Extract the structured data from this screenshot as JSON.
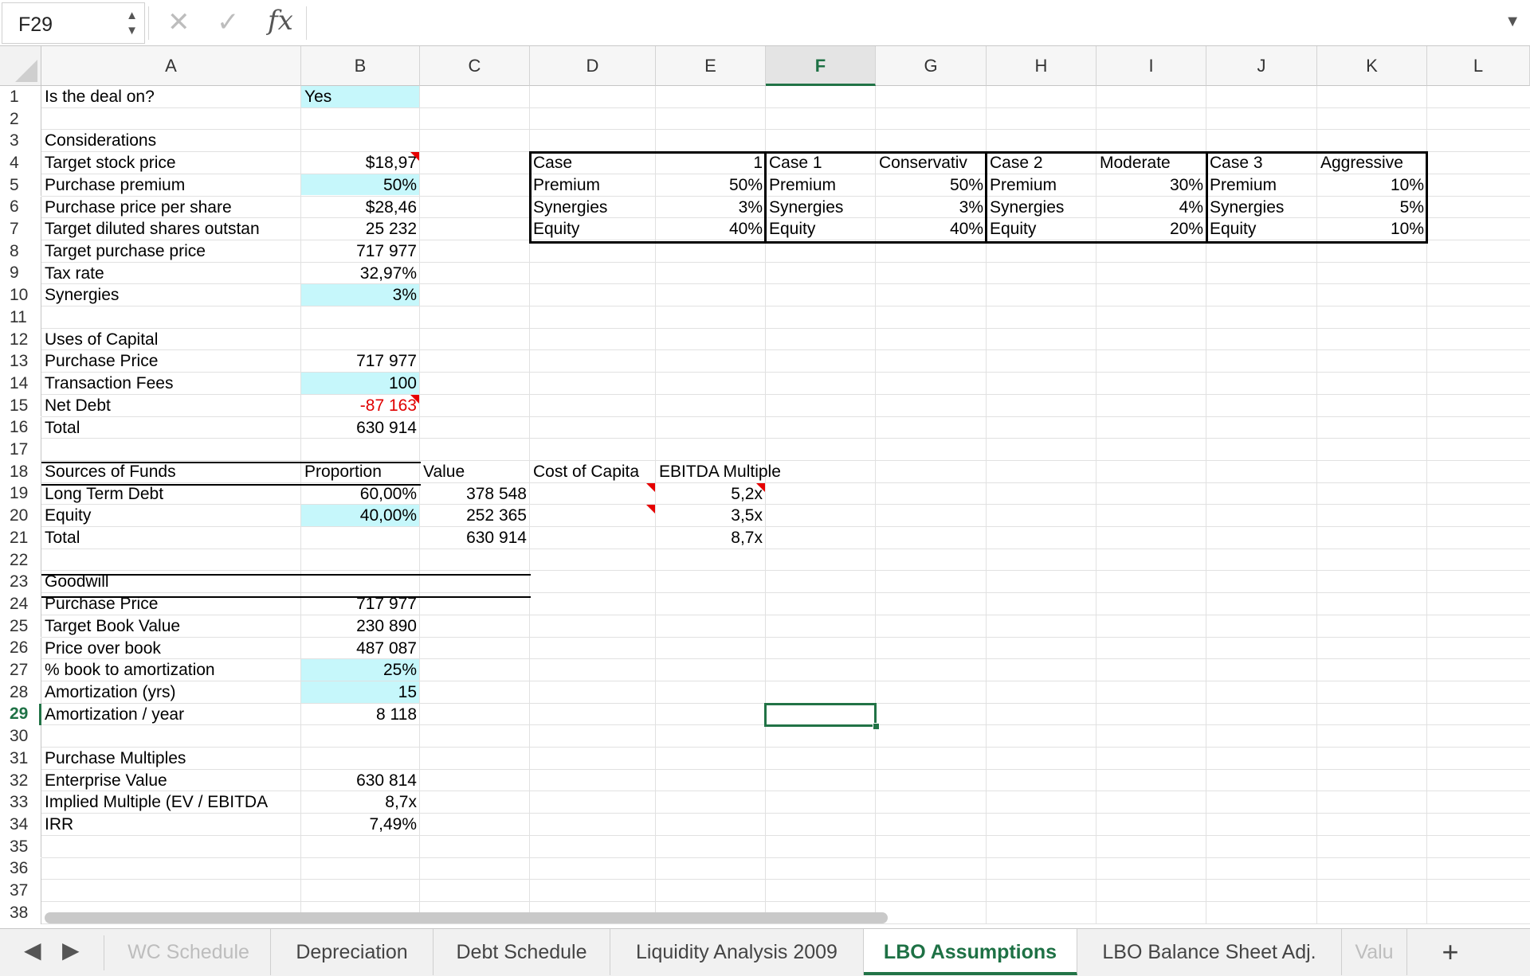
{
  "formula_bar": {
    "cell_ref": "F29",
    "stepper_up": "▲",
    "stepper_down": "▼",
    "cancel_icon": "✕",
    "enter_icon": "✓",
    "fx_label": "fx",
    "dropdown_icon": "▼",
    "formula": ""
  },
  "grid": {
    "columns": [
      "A",
      "B",
      "C",
      "D",
      "E",
      "F",
      "G",
      "H",
      "I",
      "J",
      "K",
      "L"
    ],
    "active_column": "F",
    "active_row": 29,
    "row_count": 38,
    "fill_color": "#c6f7fb",
    "selection_color": "#217346",
    "cells": [
      {
        "c": "A",
        "r": 1,
        "v": "Is the deal on?"
      },
      {
        "c": "B",
        "r": 1,
        "v": "Yes"
      },
      {
        "c": "A",
        "r": 3,
        "v": "Considerations"
      },
      {
        "c": "A",
        "r": 4,
        "v": "Target stock price"
      },
      {
        "c": "B",
        "r": 4,
        "v": "$18,97",
        "a": "r"
      },
      {
        "c": "A",
        "r": 5,
        "v": "Purchase premium"
      },
      {
        "c": "B",
        "r": 5,
        "v": "50%",
        "a": "r"
      },
      {
        "c": "A",
        "r": 6,
        "v": "Purchase price per share"
      },
      {
        "c": "B",
        "r": 6,
        "v": "$28,46",
        "a": "r"
      },
      {
        "c": "A",
        "r": 7,
        "v": "Target diluted shares outstan"
      },
      {
        "c": "B",
        "r": 7,
        "v": "25 232",
        "a": "r"
      },
      {
        "c": "A",
        "r": 8,
        "v": "Target purchase price"
      },
      {
        "c": "B",
        "r": 8,
        "v": "717 977",
        "a": "r"
      },
      {
        "c": "A",
        "r": 9,
        "v": "Tax rate"
      },
      {
        "c": "B",
        "r": 9,
        "v": "32,97%",
        "a": "r"
      },
      {
        "c": "A",
        "r": 10,
        "v": "Synergies"
      },
      {
        "c": "B",
        "r": 10,
        "v": "3%",
        "a": "r"
      },
      {
        "c": "A",
        "r": 12,
        "v": "Uses of Capital"
      },
      {
        "c": "A",
        "r": 13,
        "v": "Purchase Price"
      },
      {
        "c": "B",
        "r": 13,
        "v": "717 977",
        "a": "r"
      },
      {
        "c": "A",
        "r": 14,
        "v": "Transaction Fees"
      },
      {
        "c": "B",
        "r": 14,
        "v": "100",
        "a": "r"
      },
      {
        "c": "A",
        "r": 15,
        "v": "Net Debt"
      },
      {
        "c": "B",
        "r": 15,
        "v": "-87 163",
        "a": "r",
        "color": "neg"
      },
      {
        "c": "A",
        "r": 16,
        "v": "Total"
      },
      {
        "c": "B",
        "r": 16,
        "v": "630 914",
        "a": "r"
      },
      {
        "c": "A",
        "r": 18,
        "v": "Sources of Funds"
      },
      {
        "c": "B",
        "r": 18,
        "v": "Proportion"
      },
      {
        "c": "C",
        "r": 18,
        "v": "Value"
      },
      {
        "c": "D",
        "r": 18,
        "v": "Cost of Capita"
      },
      {
        "c": "E",
        "r": 18,
        "v": "EBITDA Multiple",
        "overflow": true
      },
      {
        "c": "A",
        "r": 19,
        "v": "Long Term Debt"
      },
      {
        "c": "B",
        "r": 19,
        "v": "60,00%",
        "a": "r"
      },
      {
        "c": "C",
        "r": 19,
        "v": "378 548",
        "a": "r"
      },
      {
        "c": "E",
        "r": 19,
        "v": "5,2x",
        "a": "r"
      },
      {
        "c": "A",
        "r": 20,
        "v": "Equity"
      },
      {
        "c": "B",
        "r": 20,
        "v": "40,00%",
        "a": "r"
      },
      {
        "c": "C",
        "r": 20,
        "v": "252 365",
        "a": "r"
      },
      {
        "c": "E",
        "r": 20,
        "v": "3,5x",
        "a": "r"
      },
      {
        "c": "A",
        "r": 21,
        "v": "Total"
      },
      {
        "c": "C",
        "r": 21,
        "v": "630 914",
        "a": "r"
      },
      {
        "c": "E",
        "r": 21,
        "v": "8,7x",
        "a": "r"
      },
      {
        "c": "A",
        "r": 23,
        "v": "Goodwill"
      },
      {
        "c": "A",
        "r": 24,
        "v": "Purchase Price"
      },
      {
        "c": "B",
        "r": 24,
        "v": "717 977",
        "a": "r"
      },
      {
        "c": "A",
        "r": 25,
        "v": "Target Book Value"
      },
      {
        "c": "B",
        "r": 25,
        "v": "230 890",
        "a": "r"
      },
      {
        "c": "A",
        "r": 26,
        "v": "Price over book"
      },
      {
        "c": "B",
        "r": 26,
        "v": "487 087",
        "a": "r"
      },
      {
        "c": "A",
        "r": 27,
        "v": "% book to amortization"
      },
      {
        "c": "B",
        "r": 27,
        "v": "25%",
        "a": "r"
      },
      {
        "c": "A",
        "r": 28,
        "v": "Amortization (yrs)"
      },
      {
        "c": "B",
        "r": 28,
        "v": "15",
        "a": "r"
      },
      {
        "c": "A",
        "r": 29,
        "v": "Amortization / year"
      },
      {
        "c": "B",
        "r": 29,
        "v": "8 118",
        "a": "r"
      },
      {
        "c": "A",
        "r": 31,
        "v": "Purchase Multiples"
      },
      {
        "c": "A",
        "r": 32,
        "v": "Enterprise Value"
      },
      {
        "c": "B",
        "r": 32,
        "v": "630 814",
        "a": "r"
      },
      {
        "c": "A",
        "r": 33,
        "v": "Implied Multiple (EV / EBITDA"
      },
      {
        "c": "B",
        "r": 33,
        "v": "8,7x",
        "a": "r"
      },
      {
        "c": "A",
        "r": 34,
        "v": "IRR"
      },
      {
        "c": "B",
        "r": 34,
        "v": "7,49%",
        "a": "r"
      },
      {
        "c": "D",
        "r": 4,
        "v": "Case"
      },
      {
        "c": "E",
        "r": 4,
        "v": "1",
        "a": "r"
      },
      {
        "c": "D",
        "r": 5,
        "v": "Premium"
      },
      {
        "c": "E",
        "r": 5,
        "v": "50%",
        "a": "r"
      },
      {
        "c": "D",
        "r": 6,
        "v": "Synergies"
      },
      {
        "c": "E",
        "r": 6,
        "v": "3%",
        "a": "r"
      },
      {
        "c": "D",
        "r": 7,
        "v": "Equity"
      },
      {
        "c": "E",
        "r": 7,
        "v": "40%",
        "a": "r"
      },
      {
        "c": "F",
        "r": 4,
        "v": "Case 1"
      },
      {
        "c": "G",
        "r": 4,
        "v": "Conservativ"
      },
      {
        "c": "F",
        "r": 5,
        "v": "Premium"
      },
      {
        "c": "G",
        "r": 5,
        "v": "50%",
        "a": "r"
      },
      {
        "c": "F",
        "r": 6,
        "v": "Synergies"
      },
      {
        "c": "G",
        "r": 6,
        "v": "3%",
        "a": "r"
      },
      {
        "c": "F",
        "r": 7,
        "v": "Equity"
      },
      {
        "c": "G",
        "r": 7,
        "v": "40%",
        "a": "r"
      },
      {
        "c": "H",
        "r": 4,
        "v": "Case 2"
      },
      {
        "c": "I",
        "r": 4,
        "v": "Moderate"
      },
      {
        "c": "H",
        "r": 5,
        "v": "Premium"
      },
      {
        "c": "I",
        "r": 5,
        "v": "30%",
        "a": "r"
      },
      {
        "c": "H",
        "r": 6,
        "v": "Synergies"
      },
      {
        "c": "I",
        "r": 6,
        "v": "4%",
        "a": "r"
      },
      {
        "c": "H",
        "r": 7,
        "v": "Equity"
      },
      {
        "c": "I",
        "r": 7,
        "v": "20%",
        "a": "r"
      },
      {
        "c": "J",
        "r": 4,
        "v": "Case 3"
      },
      {
        "c": "K",
        "r": 4,
        "v": "Aggressive"
      },
      {
        "c": "J",
        "r": 5,
        "v": "Premium"
      },
      {
        "c": "K",
        "r": 5,
        "v": "10%",
        "a": "r"
      },
      {
        "c": "J",
        "r": 6,
        "v": "Synergies"
      },
      {
        "c": "K",
        "r": 6,
        "v": "5%",
        "a": "r"
      },
      {
        "c": "J",
        "r": 7,
        "v": "Equity"
      },
      {
        "c": "K",
        "r": 7,
        "v": "10%",
        "a": "r"
      }
    ],
    "filled_cells": [
      {
        "c": "B",
        "r": 1
      },
      {
        "c": "B",
        "r": 5
      },
      {
        "c": "B",
        "r": 10
      },
      {
        "c": "B",
        "r": 14
      },
      {
        "c": "B",
        "r": 20
      },
      {
        "c": "B",
        "r": 27
      },
      {
        "c": "B",
        "r": 28
      }
    ],
    "comment_cells": [
      {
        "c": "B",
        "r": 4
      },
      {
        "c": "B",
        "r": 15
      },
      {
        "c": "D",
        "r": 19
      },
      {
        "c": "D",
        "r": 20
      },
      {
        "c": "E",
        "r": 19
      }
    ]
  },
  "sheet_tabs": {
    "prev_icon": "◀",
    "next_icon": "▶",
    "add_icon": "+",
    "tabs": [
      {
        "label": "WC Schedule",
        "state": "faded"
      },
      {
        "label": "Depreciation",
        "state": "normal"
      },
      {
        "label": "Debt Schedule",
        "state": "normal"
      },
      {
        "label": "Liquidity Analysis 2009",
        "state": "normal"
      },
      {
        "label": "LBO Assumptions",
        "state": "active"
      },
      {
        "label": "LBO Balance Sheet Adj.",
        "state": "normal"
      },
      {
        "label": "Valu",
        "state": "faded"
      }
    ]
  }
}
